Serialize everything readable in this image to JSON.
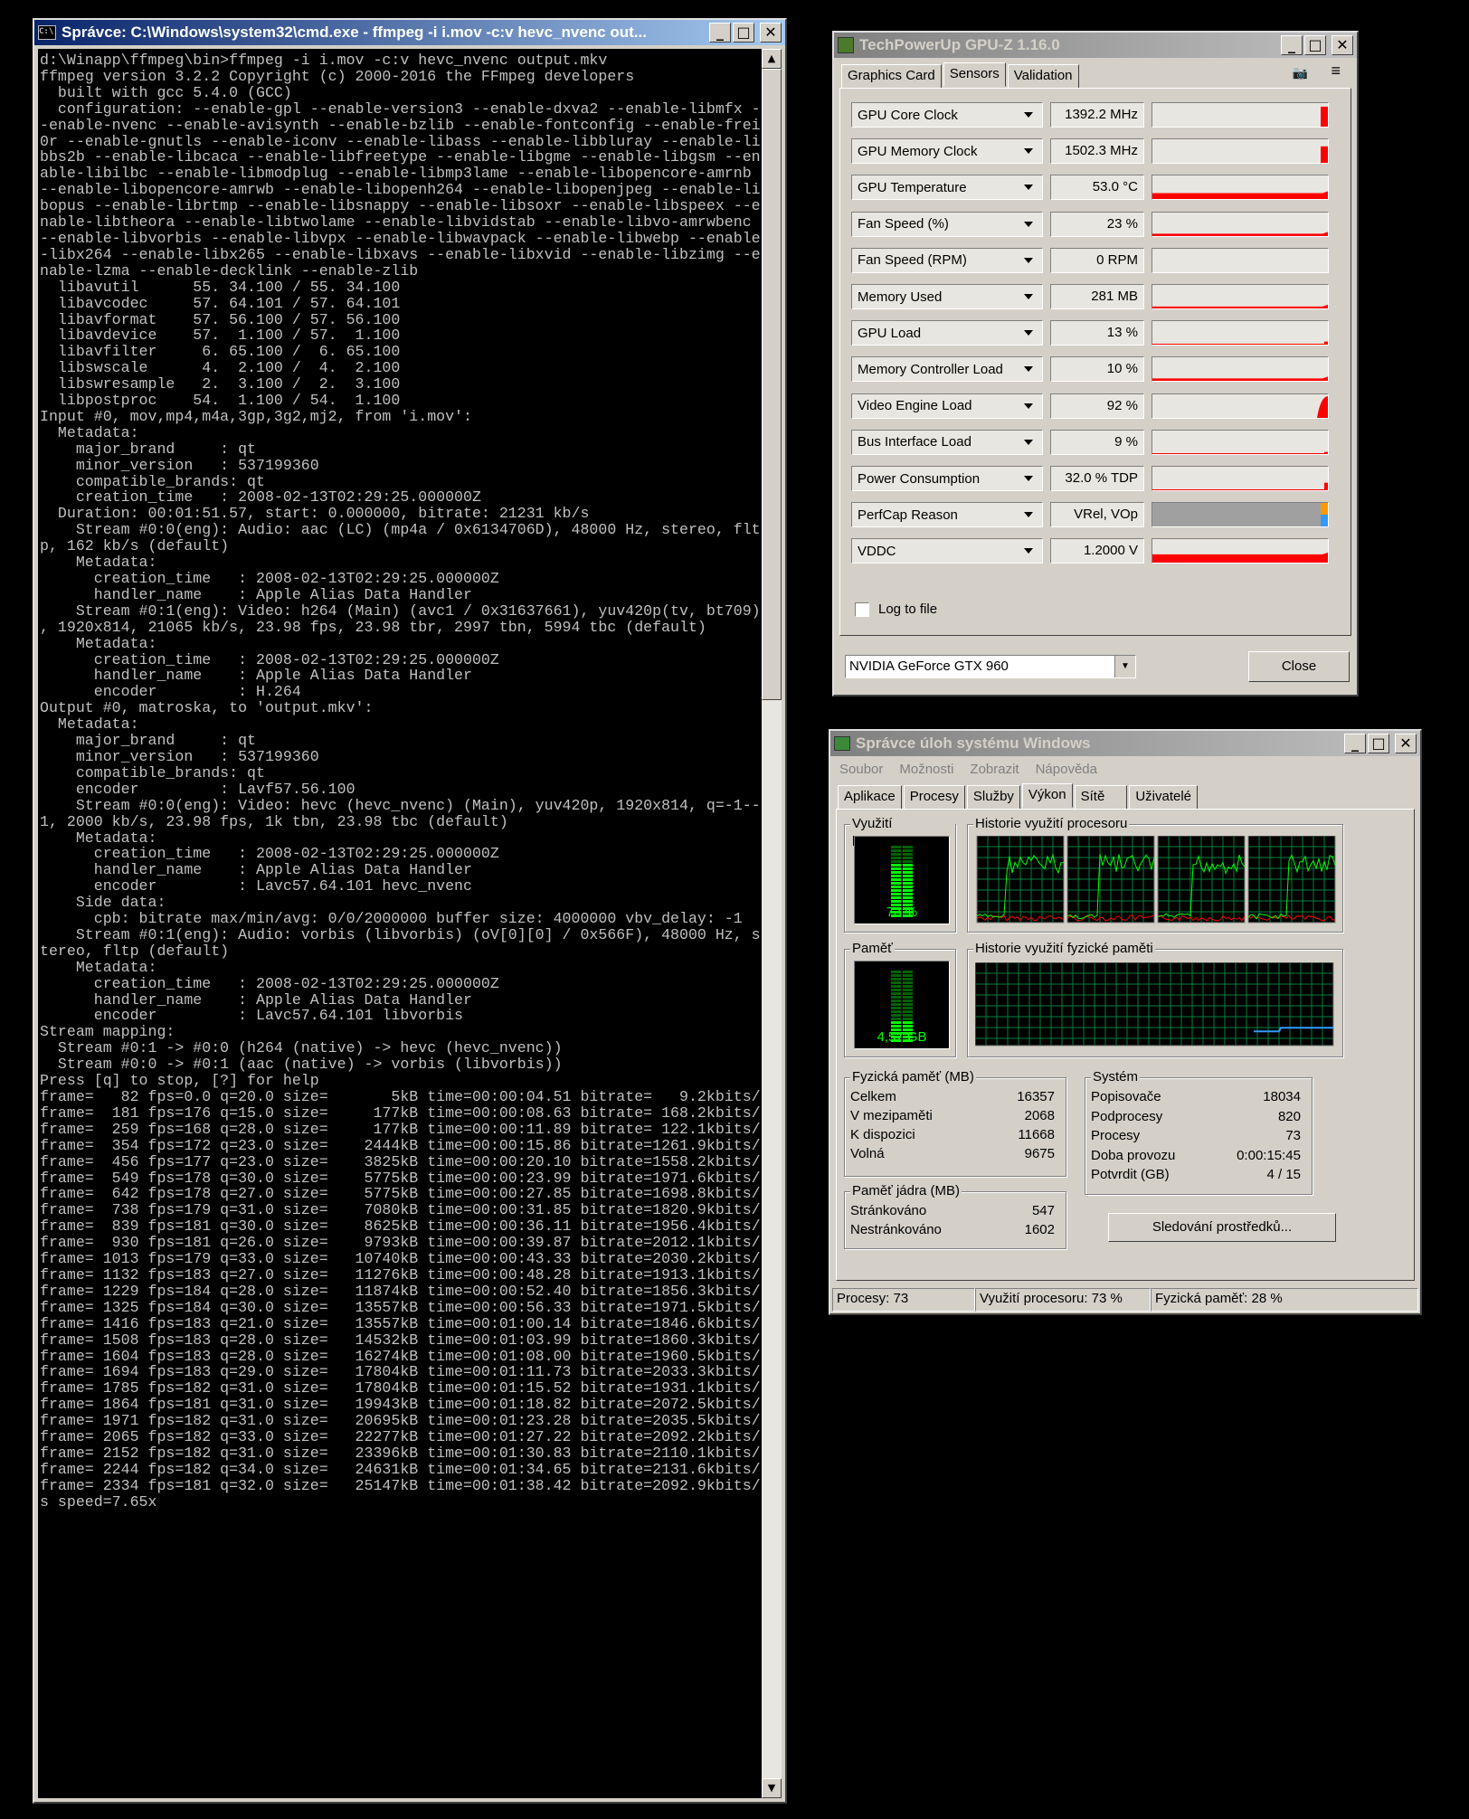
{
  "cmd": {
    "title": "Správce: C:\\Windows\\system32\\cmd.exe - ffmpeg  -i i.mov -c:v hevc_nvenc out...",
    "lines": [
      "d:\\Winapp\\ffmpeg\\bin>ffmpeg -i i.mov -c:v hevc_nvenc output.mkv",
      "ffmpeg version 3.2.2 Copyright (c) 2000-2016 the FFmpeg developers",
      "  built with gcc 5.4.0 (GCC)",
      "  configuration: --enable-gpl --enable-version3 --enable-dxva2 --enable-libmfx -",
      "-enable-nvenc --enable-avisynth --enable-bzlib --enable-fontconfig --enable-frei",
      "0r --enable-gnutls --enable-iconv --enable-libass --enable-libbluray --enable-li",
      "bbs2b --enable-libcaca --enable-libfreetype --enable-libgme --enable-libgsm --en",
      "able-libilbc --enable-libmodplug --enable-libmp3lame --enable-libopencore-amrnb ",
      "--enable-libopencore-amrwb --enable-libopenh264 --enable-libopenjpeg --enable-li",
      "bopus --enable-librtmp --enable-libsnappy --enable-libsoxr --enable-libspeex --e",
      "nable-libtheora --enable-libtwolame --enable-libvidstab --enable-libvo-amrwbenc ",
      "--enable-libvorbis --enable-libvpx --enable-libwavpack --enable-libwebp --enable",
      "-libx264 --enable-libx265 --enable-libxavs --enable-libxvid --enable-libzimg --e",
      "nable-lzma --enable-decklink --enable-zlib",
      "  libavutil      55. 34.100 / 55. 34.100",
      "  libavcodec     57. 64.101 / 57. 64.101",
      "  libavformat    57. 56.100 / 57. 56.100",
      "  libavdevice    57.  1.100 / 57.  1.100",
      "  libavfilter     6. 65.100 /  6. 65.100",
      "  libswscale      4.  2.100 /  4.  2.100",
      "  libswresample   2.  3.100 /  2.  3.100",
      "  libpostproc    54.  1.100 / 54.  1.100",
      "Input #0, mov,mp4,m4a,3gp,3g2,mj2, from 'i.mov':",
      "  Metadata:",
      "    major_brand     : qt",
      "    minor_version   : 537199360",
      "    compatible_brands: qt",
      "    creation_time   : 2008-02-13T02:29:25.000000Z",
      "  Duration: 00:01:51.57, start: 0.000000, bitrate: 21231 kb/s",
      "    Stream #0:0(eng): Audio: aac (LC) (mp4a / 0x6134706D), 48000 Hz, stereo, flt",
      "p, 162 kb/s (default)",
      "    Metadata:",
      "      creation_time   : 2008-02-13T02:29:25.000000Z",
      "      handler_name    : Apple Alias Data Handler",
      "    Stream #0:1(eng): Video: h264 (Main) (avc1 / 0x31637661), yuv420p(tv, bt709)",
      ", 1920x814, 21065 kb/s, 23.98 fps, 23.98 tbr, 2997 tbn, 5994 tbc (default)",
      "    Metadata:",
      "      creation_time   : 2008-02-13T02:29:25.000000Z",
      "      handler_name    : Apple Alias Data Handler",
      "      encoder         : H.264",
      "Output #0, matroska, to 'output.mkv':",
      "  Metadata:",
      "    major_brand     : qt",
      "    minor_version   : 537199360",
      "    compatible_brands: qt",
      "    encoder         : Lavf57.56.100",
      "    Stream #0:0(eng): Video: hevc (hevc_nvenc) (Main), yuv420p, 1920x814, q=-1--",
      "1, 2000 kb/s, 23.98 fps, 1k tbn, 23.98 tbc (default)",
      "    Metadata:",
      "      creation_time   : 2008-02-13T02:29:25.000000Z",
      "      handler_name    : Apple Alias Data Handler",
      "      encoder         : Lavc57.64.101 hevc_nvenc",
      "    Side data:",
      "      cpb: bitrate max/min/avg: 0/0/2000000 buffer size: 4000000 vbv_delay: -1",
      "    Stream #0:1(eng): Audio: vorbis (libvorbis) (oV[0][0] / 0x566F), 48000 Hz, s",
      "tereo, fltp (default)",
      "    Metadata:",
      "      creation_time   : 2008-02-13T02:29:25.000000Z",
      "      handler_name    : Apple Alias Data Handler",
      "      encoder         : Lavc57.64.101 libvorbis",
      "Stream mapping:",
      "  Stream #0:1 -> #0:0 (h264 (native) -> hevc (hevc_nvenc))",
      "  Stream #0:0 -> #0:1 (aac (native) -> vorbis (libvorbis))",
      "Press [q] to stop, [?] for help",
      "frame=   82 fps=0.0 q=20.0 size=       5kB time=00:00:04.51 bitrate=   9.2kbits/",
      "frame=  181 fps=176 q=15.0 size=     177kB time=00:00:08.63 bitrate= 168.2kbits/",
      "frame=  259 fps=168 q=28.0 size=     177kB time=00:00:11.89 bitrate= 122.1kbits/",
      "frame=  354 fps=172 q=23.0 size=    2444kB time=00:00:15.86 bitrate=1261.9kbits/",
      "frame=  456 fps=177 q=23.0 size=    3825kB time=00:00:20.10 bitrate=1558.2kbits/",
      "frame=  549 fps=178 q=30.0 size=    5775kB time=00:00:23.99 bitrate=1971.6kbits/",
      "frame=  642 fps=178 q=27.0 size=    5775kB time=00:00:27.85 bitrate=1698.8kbits/",
      "frame=  738 fps=179 q=31.0 size=    7080kB time=00:00:31.85 bitrate=1820.9kbits/",
      "frame=  839 fps=181 q=30.0 size=    8625kB time=00:00:36.11 bitrate=1956.4kbits/",
      "frame=  930 fps=181 q=26.0 size=    9793kB time=00:00:39.87 bitrate=2012.1kbits/",
      "frame= 1013 fps=179 q=33.0 size=   10740kB time=00:00:43.33 bitrate=2030.2kbits/",
      "frame= 1132 fps=183 q=27.0 size=   11276kB time=00:00:48.28 bitrate=1913.1kbits/",
      "frame= 1229 fps=184 q=28.0 size=   11874kB time=00:00:52.40 bitrate=1856.3kbits/",
      "frame= 1325 fps=184 q=30.0 size=   13557kB time=00:00:56.33 bitrate=1971.5kbits/",
      "frame= 1416 fps=183 q=21.0 size=   13557kB time=00:01:00.14 bitrate=1846.6kbits/",
      "frame= 1508 fps=183 q=28.0 size=   14532kB time=00:01:03.99 bitrate=1860.3kbits/",
      "frame= 1604 fps=183 q=28.0 size=   16274kB time=00:01:08.00 bitrate=1960.5kbits/",
      "frame= 1694 fps=183 q=29.0 size=   17804kB time=00:01:11.73 bitrate=2033.3kbits/",
      "frame= 1785 fps=182 q=31.0 size=   17804kB time=00:01:15.52 bitrate=1931.1kbits/",
      "frame= 1864 fps=181 q=31.0 size=   19943kB time=00:01:18.82 bitrate=2072.5kbits/",
      "frame= 1971 fps=182 q=31.0 size=   20695kB time=00:01:23.28 bitrate=2035.5kbits/",
      "frame= 2065 fps=182 q=33.0 size=   22277kB time=00:01:27.22 bitrate=2092.2kbits/",
      "frame= 2152 fps=182 q=31.0 size=   23396kB time=00:01:30.83 bitrate=2110.1kbits/",
      "frame= 2244 fps=182 q=34.0 size=   24631kB time=00:01:34.65 bitrate=2131.6kbits/",
      "frame= 2334 fps=181 q=32.0 size=   25147kB time=00:01:38.42 bitrate=2092.9kbits/",
      "s speed=7.65x"
    ]
  },
  "gpuz": {
    "title": "TechPowerUp GPU-Z 1.16.0",
    "tabs": [
      "Graphics Card",
      "Sensors",
      "Validation"
    ],
    "active_tab": "Sensors",
    "sensors": [
      {
        "name": "GPU Core Clock",
        "value": "1392.2 MHz",
        "level": 0.85,
        "history": "spike"
      },
      {
        "name": "GPU Memory Clock",
        "value": "1502.3 MHz",
        "level": 0.7,
        "history": "spike"
      },
      {
        "name": "GPU Temperature",
        "value": "53.0 °C",
        "level": 0.25,
        "history": "flat"
      },
      {
        "name": "Fan Speed (%)",
        "value": "23 %",
        "level": 0.1,
        "history": "flat"
      },
      {
        "name": "Fan Speed (RPM)",
        "value": "0 RPM",
        "level": 0,
        "history": "none"
      },
      {
        "name": "Memory Used",
        "value": "281 MB",
        "level": 0.08,
        "history": "flat"
      },
      {
        "name": "GPU Load",
        "value": "13 %",
        "level": 0.13,
        "history": "low"
      },
      {
        "name": "Memory Controller Load",
        "value": "10 %",
        "level": 0.1,
        "history": "flat"
      },
      {
        "name": "Video Engine Load",
        "value": "92 %",
        "level": 0.92,
        "history": "curve"
      },
      {
        "name": "Bus Interface Load",
        "value": "9 %",
        "level": 0.09,
        "history": "low"
      },
      {
        "name": "Power Consumption",
        "value": "32.0 % TDP",
        "level": 0.32,
        "history": "low"
      },
      {
        "name": "PerfCap Reason",
        "value": "VRel, VOp",
        "level": 1,
        "history": "perfcap"
      },
      {
        "name": "VDDC",
        "value": "1.2000 V",
        "level": 0.35,
        "history": "flat"
      }
    ],
    "log_label": "Log to file",
    "gpu_select": "NVIDIA GeForce GTX 960",
    "close_label": "Close",
    "colors": {
      "graph": "#ff0000",
      "perfcap_orange": "#ff9900",
      "perfcap_blue": "#3399ff",
      "perfcap_bg": "#a0a0a0"
    }
  },
  "taskmgr": {
    "title": "Správce úloh systému Windows",
    "menu": [
      "Soubor",
      "Možnosti",
      "Zobrazit",
      "Nápověda"
    ],
    "tabs": [
      "Aplikace",
      "Procesy",
      "Služby",
      "Výkon",
      "Sítě",
      "Uživatelé"
    ],
    "active_tab": "Výkon",
    "cpu_usage_label": "Využití procesoru",
    "cpu_usage_value": "73 %",
    "cpu_usage_percent": 73,
    "cpu_history_label": "Historie využití procesoru",
    "mem_label": "Paměť",
    "mem_value": "4,57 GB",
    "mem_percent": 28,
    "mem_history_label": "Historie využití fyzické paměti",
    "physical": {
      "label": "Fyzická paměť (MB)",
      "rows": [
        {
          "k": "Celkem",
          "v": "16357"
        },
        {
          "k": "V mezipaměti",
          "v": "2068"
        },
        {
          "k": "K dispozici",
          "v": "11668"
        },
        {
          "k": "Volná",
          "v": "9675"
        }
      ]
    },
    "kernel": {
      "label": "Paměť jádra (MB)",
      "rows": [
        {
          "k": "Stránkováno",
          "v": "547"
        },
        {
          "k": "Nestránkováno",
          "v": "1602"
        }
      ]
    },
    "system": {
      "label": "Systém",
      "rows": [
        {
          "k": "Popisovače",
          "v": "18034"
        },
        {
          "k": "Podprocesy",
          "v": "820"
        },
        {
          "k": "Procesy",
          "v": "73"
        },
        {
          "k": "Doba provozu",
          "v": "0:00:15:45"
        },
        {
          "k": "Potvrdit (GB)",
          "v": "4 / 15"
        }
      ]
    },
    "monitor_button": "Sledování prostředků...",
    "status": {
      "processes": "Procesy: 73",
      "cpu": "Využití procesoru: 73 %",
      "memory": "Fyzická paměť: 28 %"
    }
  }
}
